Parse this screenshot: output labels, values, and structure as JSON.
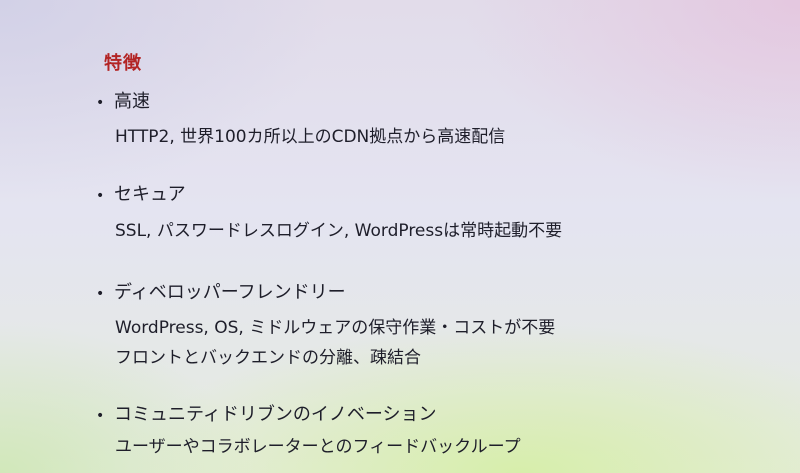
{
  "slide": {
    "title": "特徴",
    "bullet_symbol": "•",
    "items": [
      {
        "heading": "高速",
        "details": [
          "HTTP2, 世界100カ所以上のCDN拠点から高速配信"
        ]
      },
      {
        "heading": "セキュア",
        "details": [
          "SSL, パスワードレスログイン, WordPressは常時起動不要"
        ]
      },
      {
        "heading": "ディベロッパーフレンドリー",
        "details": [
          "WordPress, OS, ミドルウェアの保守作業・コストが不要",
          "フロントとバックエンドの分離、疎結合"
        ]
      },
      {
        "heading": "コミュニティドリブンのイノベーション",
        "details": [
          "ユーザーやコラボレーターとのフィードバックループ"
        ]
      }
    ]
  }
}
